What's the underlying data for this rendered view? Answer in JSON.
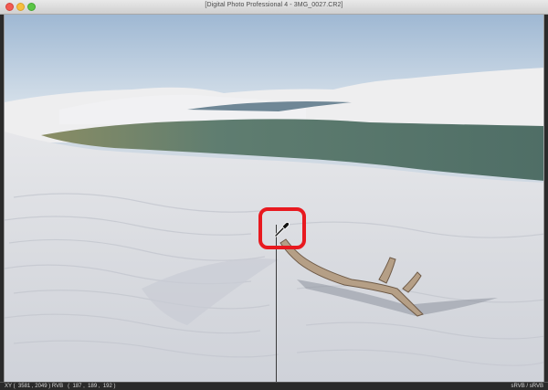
{
  "window": {
    "title": "[Digital Photo Professional 4 - 3MG_0027.CR2]"
  },
  "viewer": {
    "image_description_icon": "dunes-lagoon-photo",
    "tool_icon": "eyedropper-icon"
  },
  "statusbar": {
    "readout": "XY (  3581 , 2049 ) RVB   (  187 ,  189 ,  192 )",
    "profile": "sRVB / sRVB"
  },
  "colors": {
    "highlight": "#e8191f",
    "titlebar": "#d8d8d8",
    "statusbar": "#2a2a2a"
  }
}
